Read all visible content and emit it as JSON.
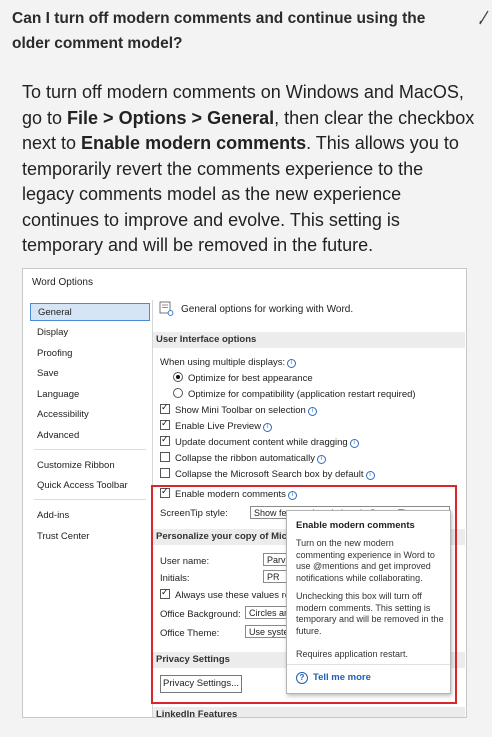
{
  "faq": {
    "question": "Can I turn off modern comments and continue using the older comment model?",
    "answer_intro": "To turn off modern comments on Windows and MacOS, go to ",
    "answer_path": "File > Options > General",
    "answer_mid": ", then clear the checkbox next to ",
    "answer_setting": "Enable modern comments",
    "answer_rest": ". This allows you to temporarily revert the comments experience to the legacy comments model as the new experience continues to improve and evolve. This setting is temporary and will be removed in the future."
  },
  "dialog": {
    "title": "Word Options",
    "nav": [
      "General",
      "Display",
      "Proofing",
      "Save",
      "Language",
      "Accessibility",
      "Advanced",
      "Customize Ribbon",
      "Quick Access Toolbar",
      "Add-ins",
      "Trust Center"
    ],
    "general_header": "General options for working with Word.",
    "ui_section": "User Interface options",
    "multi_display_label": "When using multiple displays:",
    "radio_best": "Optimize for best appearance",
    "radio_compat": "Optimize for compatibility (application restart required)",
    "cb_mini_toolbar": "Show Mini Toolbar on selection",
    "cb_live_preview": "Enable Live Preview",
    "cb_update_drag": "Update document content while dragging",
    "cb_collapse_ribbon": "Collapse the ribbon automatically",
    "cb_collapse_search": "Collapse the Microsoft Search box by default",
    "cb_modern_comments": "Enable modern comments",
    "screentip_label": "ScreenTip style:",
    "screentip_value": "Show feature descriptions in ScreenTips",
    "personalize_section": "Personalize your copy of Microsoft Office",
    "username_label": "User name:",
    "username_value": "Parvin Radford",
    "initials_label": "Initials:",
    "initials_value": "PR",
    "always_use": "Always use these values regardless of sign in to Office.",
    "office_bg_label": "Office Background:",
    "office_bg_value": "Circles and Stripes",
    "office_theme_label": "Office Theme:",
    "office_theme_value": "Use system setting",
    "privacy_section": "Privacy Settings",
    "privacy_button": "Privacy Settings...",
    "linkedin_section": "LinkedIn Features"
  },
  "tooltip": {
    "title": "Enable modern comments",
    "p1": "Turn on the new modern commenting experience in Word to use @mentions and get improved notifications while collaborating.",
    "p2": "Unchecking this box will turn off modern comments. This setting is temporary and will be removed in the future.",
    "p3": "Requires application restart.",
    "more": "Tell me more"
  },
  "colors": {
    "highlight": "#d9262b",
    "link": "#1f5fb5",
    "nav_selected": "#d5e5f6"
  }
}
